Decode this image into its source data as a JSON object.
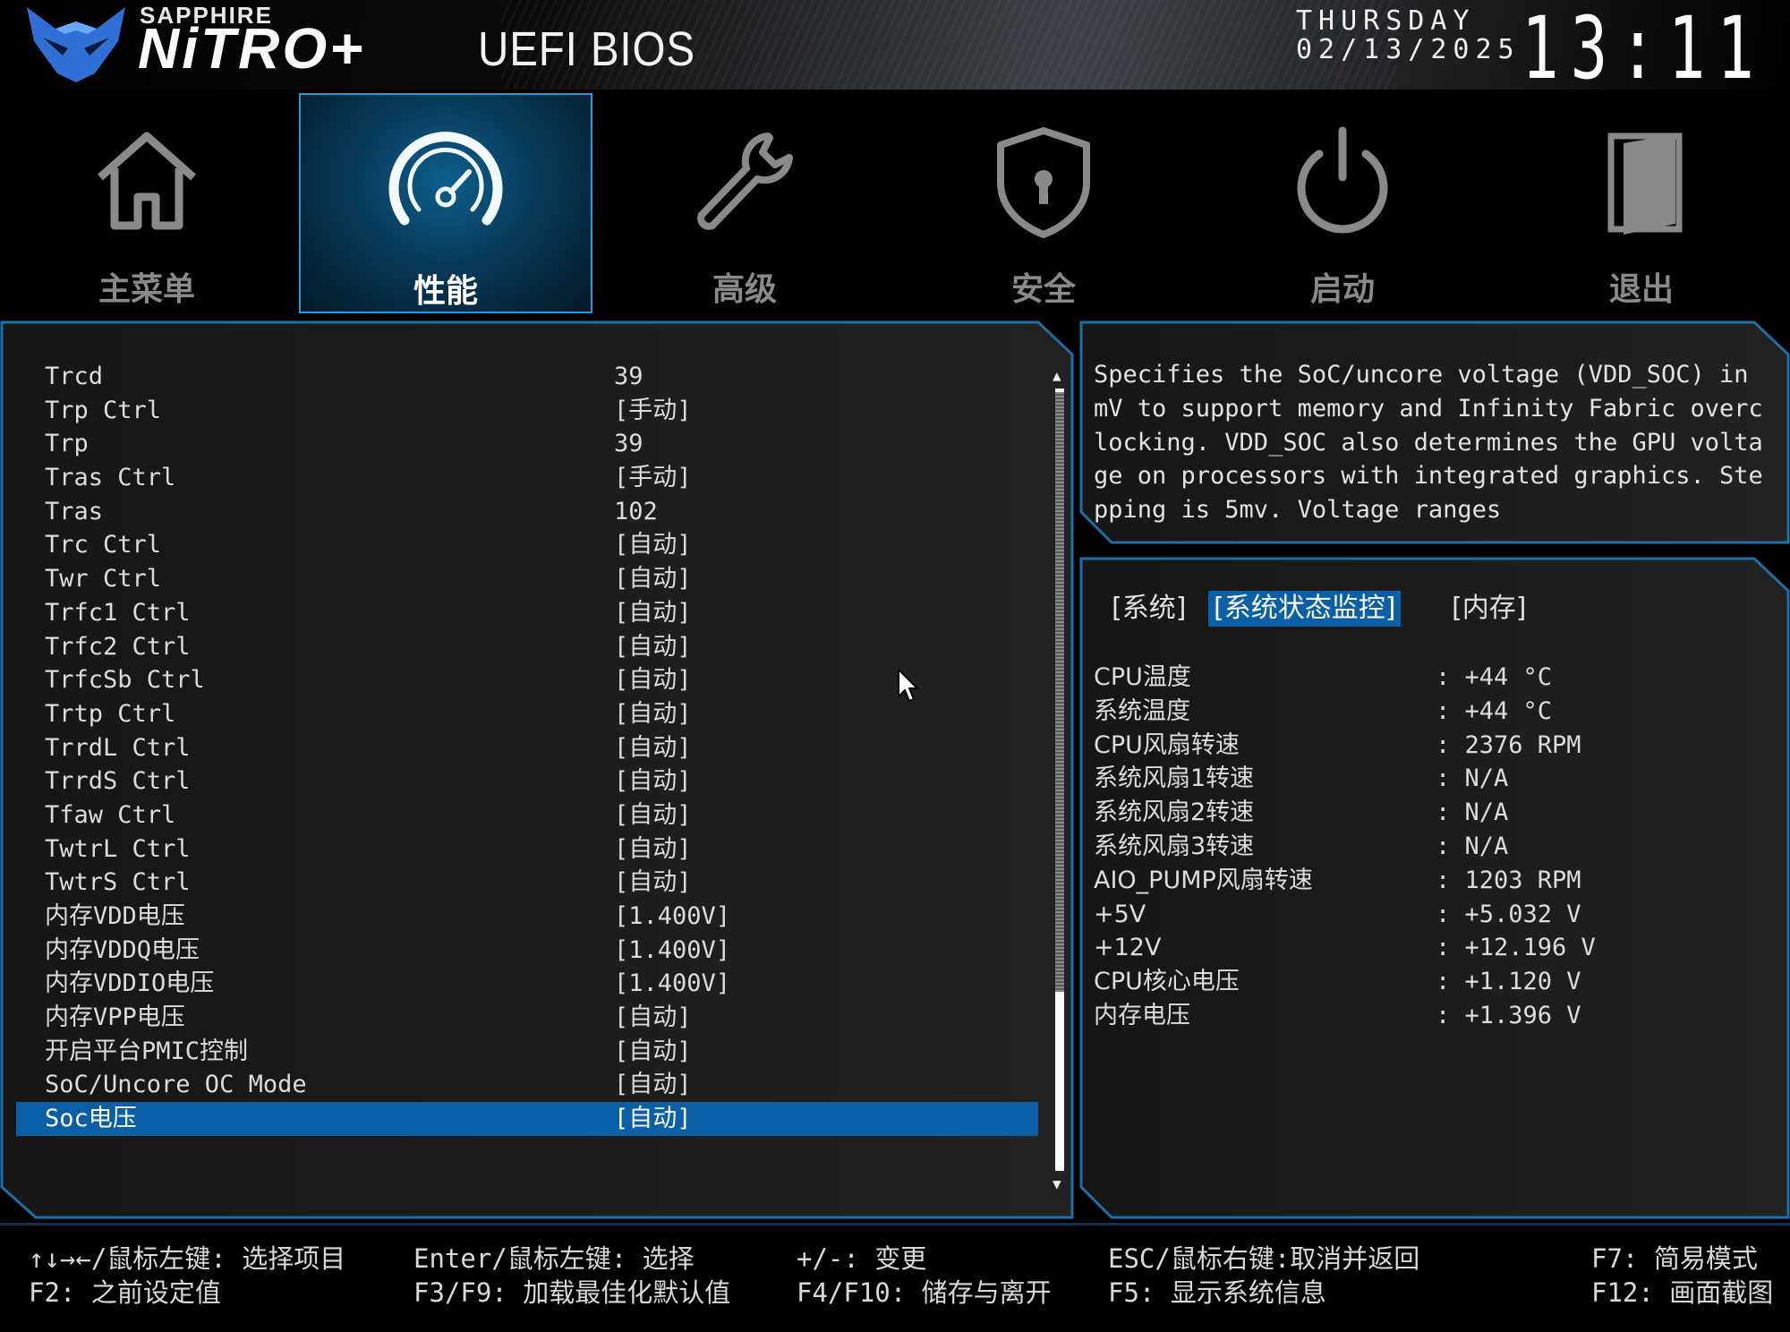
{
  "header": {
    "brand_small": "SAPPHIRE",
    "brand_big": "NiTRO+",
    "title": "UEFI BIOS",
    "day": "THURSDAY",
    "date": "02/13/2025",
    "time": "13:11"
  },
  "nav": {
    "tabs": [
      {
        "label": "主菜单",
        "icon": "home-icon"
      },
      {
        "label": "性能",
        "icon": "speedometer-icon"
      },
      {
        "label": "高级",
        "icon": "wrench-icon"
      },
      {
        "label": "安全",
        "icon": "shield-lock-icon"
      },
      {
        "label": "启动",
        "icon": "power-icon"
      },
      {
        "label": "退出",
        "icon": "exit-door-icon"
      }
    ],
    "active_tab": "性能",
    "accent_color": "#1e9be0"
  },
  "settings": {
    "rows": [
      {
        "label": "Trcd",
        "value": "39"
      },
      {
        "label": "Trp Ctrl",
        "value": "[手动]"
      },
      {
        "label": "Trp",
        "value": "39"
      },
      {
        "label": "Tras Ctrl",
        "value": "[手动]"
      },
      {
        "label": "Tras",
        "value": "102"
      },
      {
        "label": "Trc Ctrl",
        "value": "[自动]"
      },
      {
        "label": "Twr Ctrl",
        "value": "[自动]"
      },
      {
        "label": "Trfc1 Ctrl",
        "value": "[自动]"
      },
      {
        "label": "Trfc2 Ctrl",
        "value": "[自动]"
      },
      {
        "label": "TrfcSb Ctrl",
        "value": "[自动]"
      },
      {
        "label": "Trtp Ctrl",
        "value": "[自动]"
      },
      {
        "label": "TrrdL Ctrl",
        "value": "[自动]"
      },
      {
        "label": "TrrdS Ctrl",
        "value": "[自动]"
      },
      {
        "label": "Tfaw Ctrl",
        "value": "[自动]"
      },
      {
        "label": "TwtrL Ctrl",
        "value": "[自动]"
      },
      {
        "label": "TwtrS Ctrl",
        "value": "[自动]"
      },
      {
        "label": "内存VDD电压",
        "value": "[1.400V]"
      },
      {
        "label": "内存VDDQ电压",
        "value": "[1.400V]"
      },
      {
        "label": "内存VDDIO电压",
        "value": "[1.400V]"
      },
      {
        "label": "内存VPP电压",
        "value": "[自动]"
      },
      {
        "label": "开启平台PMIC控制",
        "value": "[自动]"
      },
      {
        "label": "SoC/Uncore OC Mode",
        "value": "[自动]"
      },
      {
        "label": "Soc电压",
        "value": "[自动]"
      }
    ],
    "selected_index": 22,
    "selection_color": "#0b5fa6"
  },
  "help_text": "Specifies the SoC/uncore voltage (VDD_SOC) in mV to support memory and Infinity Fabric overclocking. VDD_SOC also determines the GPU voltage on processors with integrated graphics. Stepping is 5mv. Voltage ranges",
  "monitor": {
    "tabs": [
      "[系统]",
      "[系统状态监控]",
      "[内存]"
    ],
    "active_tab": "[系统状态监控]",
    "rows": [
      {
        "label": "CPU温度",
        "value": ": +44 °C"
      },
      {
        "label": "系统温度",
        "value": ": +44 °C"
      },
      {
        "label": "CPU风扇转速",
        "value": ": 2376 RPM"
      },
      {
        "label": "系统风扇1转速",
        "value": ": N/A"
      },
      {
        "label": "系统风扇2转速",
        "value": ": N/A"
      },
      {
        "label": "系统风扇3转速",
        "value": ": N/A"
      },
      {
        "label": "AIO_PUMP风扇转速",
        "value": ": 1203 RPM"
      },
      {
        "label": "+5V",
        "value": ": +5.032 V"
      },
      {
        "label": "+12V",
        "value": ": +12.196 V"
      },
      {
        "label": "CPU核心电压",
        "value": ": +1.120 V"
      },
      {
        "label": "内存电压",
        "value": ": +1.396 V"
      }
    ]
  },
  "footer": {
    "keys": [
      "↑↓→←/鼠标左键: 选择项目",
      "F2: 之前设定值",
      "Enter/鼠标左键: 选择",
      "F3/F9: 加载最佳化默认值",
      "+/-: 变更",
      "F4/F10: 储存与离开",
      "ESC/鼠标右键:取消并返回",
      "F5: 显示系统信息",
      "F7: 简易模式",
      "F12: 画面截图"
    ]
  }
}
